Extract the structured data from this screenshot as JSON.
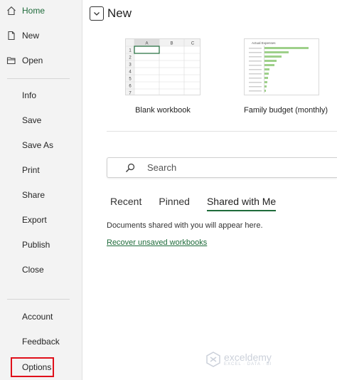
{
  "sidebar": {
    "top_items": [
      {
        "label": "Home",
        "icon": "home-icon",
        "active": true
      },
      {
        "label": "New",
        "icon": "new-file-icon"
      },
      {
        "label": "Open",
        "icon": "folder-icon"
      }
    ],
    "middle_items": [
      "Info",
      "Save",
      "Save As",
      "Print",
      "Share",
      "Export",
      "Publish",
      "Close"
    ],
    "bottom_items": [
      "Account",
      "Feedback",
      "Options"
    ]
  },
  "main": {
    "title": "New",
    "templates": [
      {
        "label": "Blank workbook",
        "columns": [
          "A",
          "B",
          "C"
        ],
        "rows": [
          "1",
          "2",
          "3",
          "4",
          "5",
          "6",
          "7"
        ]
      },
      {
        "label": "Family budget (monthly)",
        "chart_title": "Actual Expenses"
      }
    ],
    "search": {
      "placeholder": "Search"
    },
    "tabs": [
      "Recent",
      "Pinned",
      "Shared with Me"
    ],
    "active_tab": "Shared with Me",
    "empty_message": "Documents shared with you will appear here.",
    "recover_link": "Recover unsaved workbooks"
  },
  "watermark": {
    "brand": "exceldemy",
    "tagline": "EXCEL · DATA · BI"
  },
  "colors": {
    "accent": "#1e6b3a",
    "highlight": "#e0101a",
    "sidebar_bg": "#f3f3f3"
  }
}
